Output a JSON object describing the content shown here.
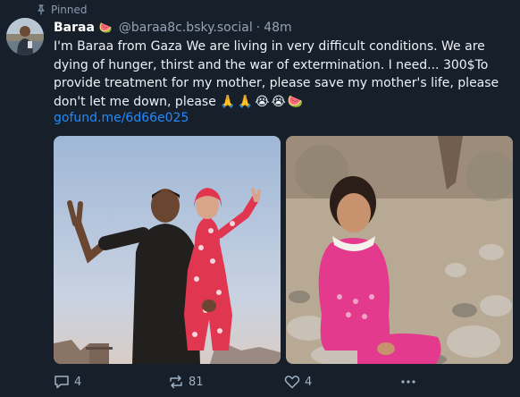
{
  "pinned_label": "Pinned",
  "author": {
    "display_name": "Baraa",
    "name_emoji": "🍉",
    "handle": "@baraa8c.bsky.social",
    "separator": "·",
    "timestamp": "48m"
  },
  "post": {
    "text": "I'm Baraa from Gaza We are living in very difficult conditions. We are dying of hunger, thirst and the war of extermination. I need... 300$To provide treatment for my mother, please save my mother's life, please don't let me down, please",
    "emojis": "🙏🙏😭😭🍉",
    "link": "gofund.me/6d66e025"
  },
  "media": [
    {
      "subject": "young man and child in red pajamas making victory signs"
    },
    {
      "subject": "girl in pink sweater sitting on rubble"
    }
  ],
  "actions": {
    "replies": "4",
    "reposts": "81",
    "likes": "4"
  },
  "colors": {
    "background": "#171f2a",
    "link": "#208bfe",
    "muted": "#93a3b5"
  },
  "icons": [
    "pin-icon",
    "reply-icon",
    "repost-icon",
    "like-icon",
    "more-options-icon"
  ]
}
